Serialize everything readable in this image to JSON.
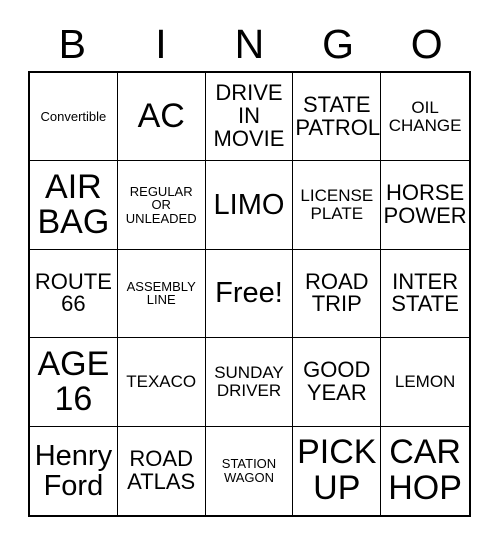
{
  "card": {
    "title_letters": [
      "B",
      "I",
      "N",
      "G",
      "O"
    ],
    "free_space": "Free!",
    "colors": {
      "background": "#ffffff",
      "text": "#000000",
      "grid_line": "#000000"
    },
    "grid": {
      "columns": 5,
      "rows": 5
    },
    "cells": [
      {
        "text": "Convertible",
        "size": "sz-xs"
      },
      {
        "text": "AC",
        "size": "sz-xl"
      },
      {
        "text": "DRIVE\nIN\nMOVIE",
        "size": "sz-md"
      },
      {
        "text": "STATE\nPATROL",
        "size": "sz-md"
      },
      {
        "text": "OIL\nCHANGE",
        "size": "sz-sm"
      },
      {
        "text": "AIR\nBAG",
        "size": "sz-xl"
      },
      {
        "text": "REGULAR\nOR\nUNLEADED",
        "size": "sz-xs"
      },
      {
        "text": "LIMO",
        "size": "sz-lg"
      },
      {
        "text": "LICENSE\nPLATE",
        "size": "sz-sm"
      },
      {
        "text": "HORSE\nPOWER",
        "size": "sz-md"
      },
      {
        "text": "ROUTE\n66",
        "size": "sz-md"
      },
      {
        "text": "ASSEMBLY\nLINE",
        "size": "sz-xs"
      },
      {
        "text": "Free!",
        "size": "sz-lg"
      },
      {
        "text": "ROAD\nTRIP",
        "size": "sz-md"
      },
      {
        "text": "INTER\nSTATE",
        "size": "sz-md"
      },
      {
        "text": "AGE\n16",
        "size": "sz-xl"
      },
      {
        "text": "TEXACO",
        "size": "sz-sm"
      },
      {
        "text": "SUNDAY\nDRIVER",
        "size": "sz-sm"
      },
      {
        "text": "GOOD\nYEAR",
        "size": "sz-md"
      },
      {
        "text": "LEMON",
        "size": "sz-sm"
      },
      {
        "text": "Henry\nFord",
        "size": "sz-lg"
      },
      {
        "text": "ROAD\nATLAS",
        "size": "sz-md"
      },
      {
        "text": "STATION\nWAGON",
        "size": "sz-xs"
      },
      {
        "text": "PICK\nUP",
        "size": "sz-xl"
      },
      {
        "text": "CAR\nHOP",
        "size": "sz-xl"
      }
    ]
  }
}
